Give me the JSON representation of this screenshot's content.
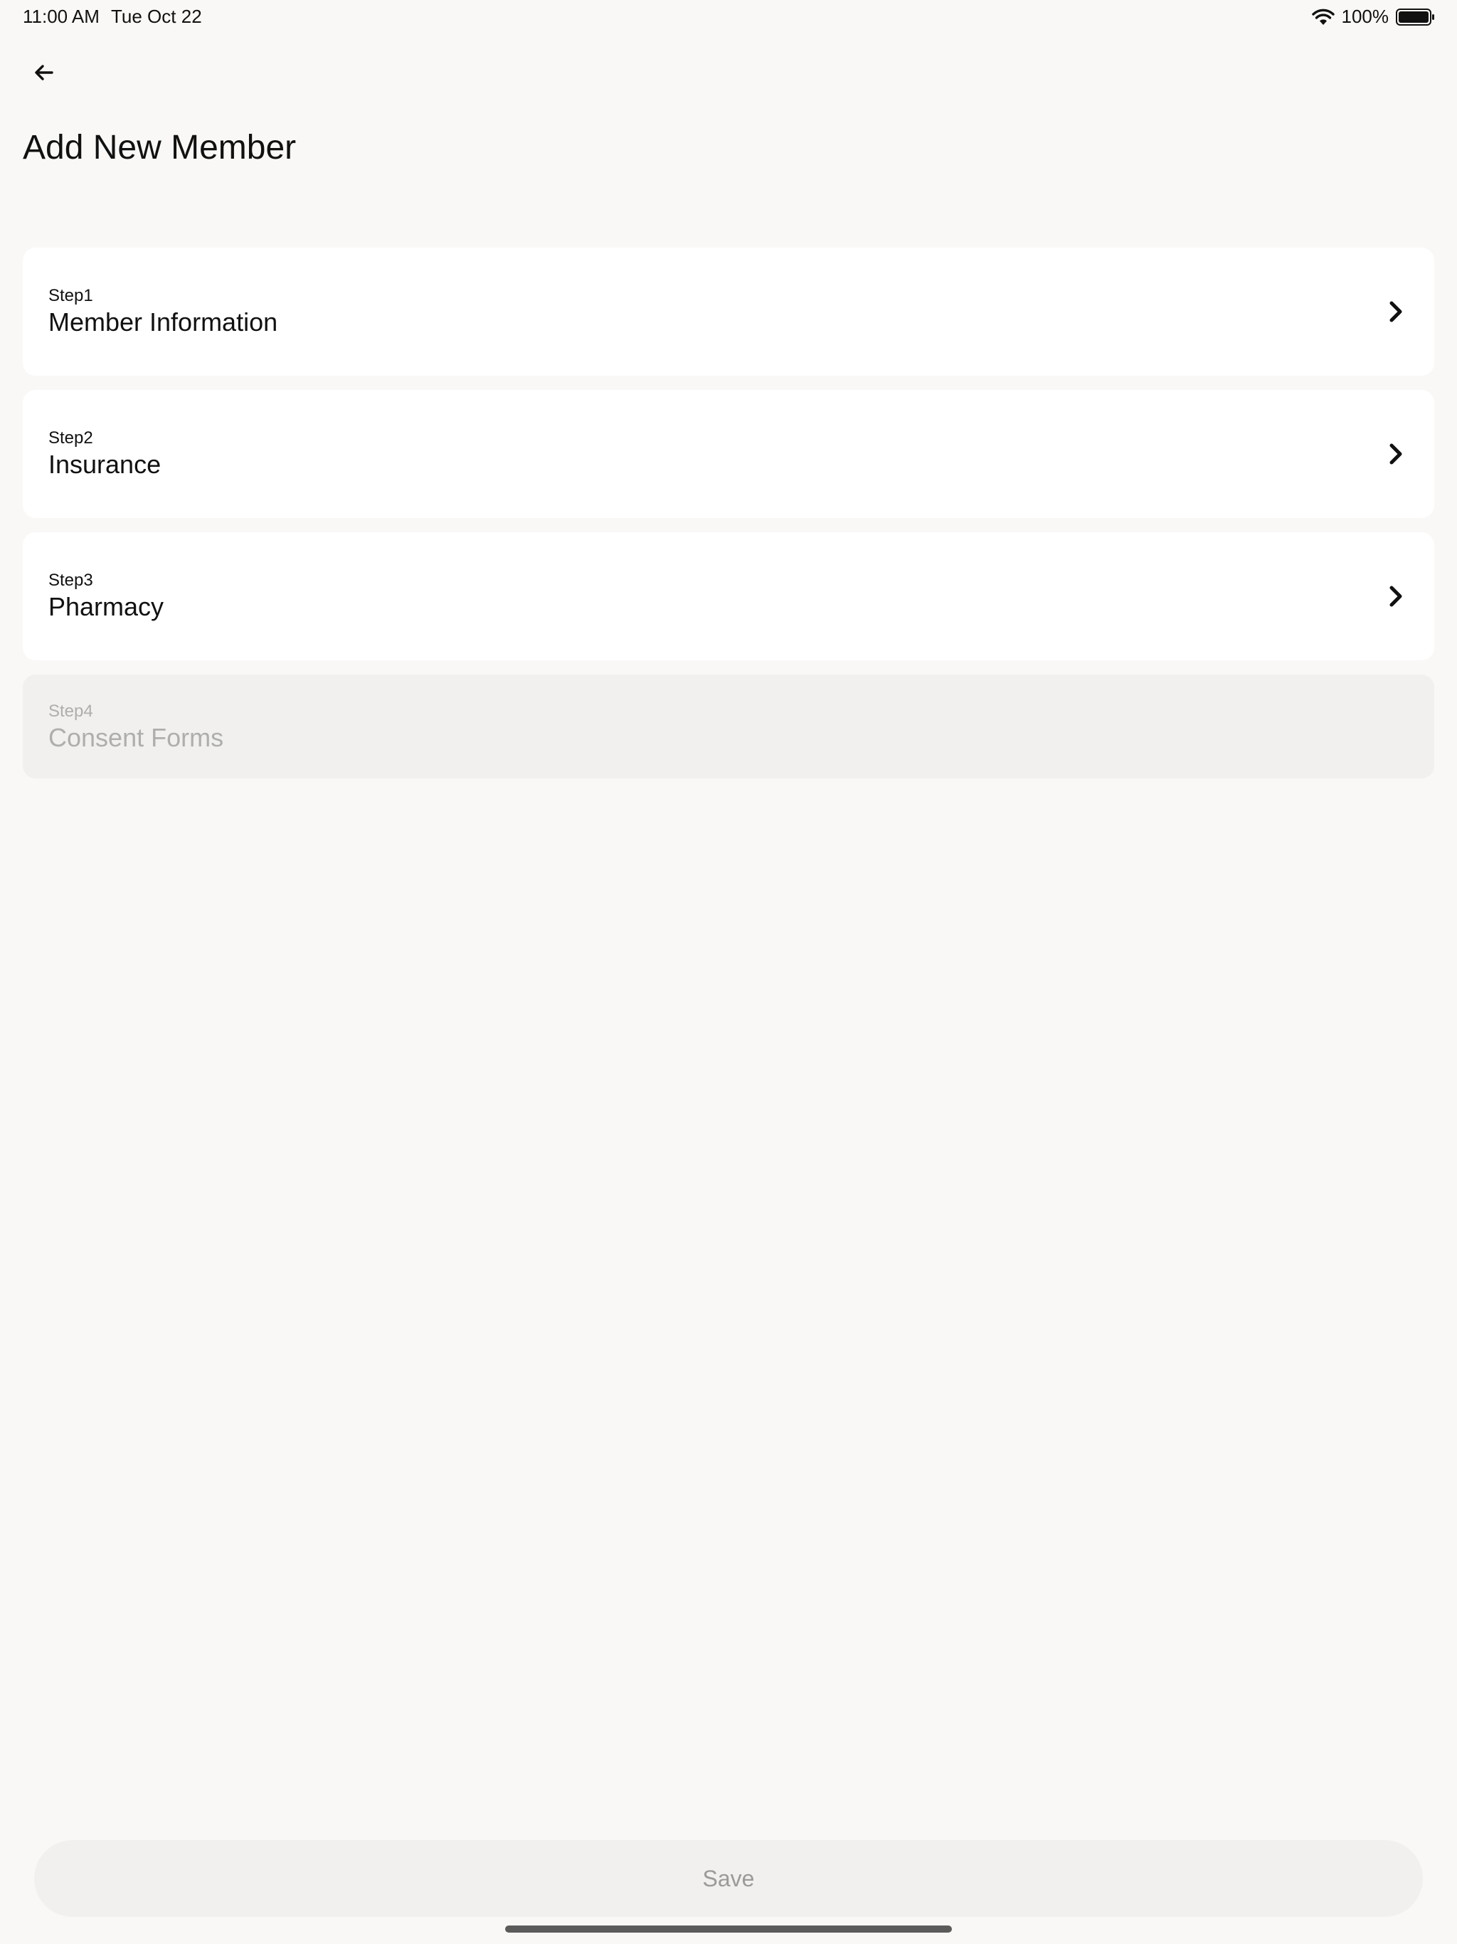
{
  "status_bar": {
    "time": "11:00 AM",
    "date": "Tue Oct 22",
    "battery": "100%",
    "icons": [
      "wifi-icon",
      "battery-icon"
    ]
  },
  "header": {
    "back_icon": "arrow-left-icon",
    "title": "Add New Member"
  },
  "steps": [
    {
      "number": "Step1",
      "title": "Member Information",
      "enabled": true
    },
    {
      "number": "Step2",
      "title": "Insurance",
      "enabled": true
    },
    {
      "number": "Step3",
      "title": "Pharmacy",
      "enabled": true
    },
    {
      "number": "Step4",
      "title": "Consent Forms",
      "enabled": false
    }
  ],
  "footer": {
    "save_label": "Save"
  },
  "colors": {
    "background": "#f9f8f6",
    "card": "#ffffff",
    "card_disabled": "#f1f0ee",
    "text": "#111111",
    "text_disabled": "#aeaeae"
  }
}
